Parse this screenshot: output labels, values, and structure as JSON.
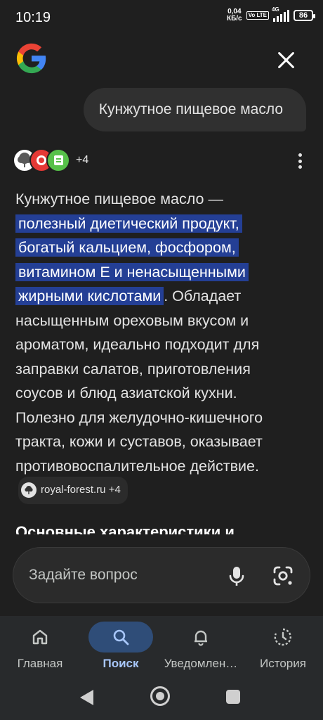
{
  "status_bar": {
    "time": "10:19",
    "net_speed_value": "0,04",
    "net_speed_unit": "КБ/с",
    "volte": "Vo LTE",
    "network": "4G",
    "battery": "86"
  },
  "header": {
    "logo_icon": "google-g-icon",
    "close_icon": "close-icon"
  },
  "query": "Кунжутное пищевое масло",
  "sources": {
    "more_count": "+4",
    "menu_icon": "more-vert-icon"
  },
  "answer": {
    "intro": "Кунжутное пищевое масло — ",
    "highlight": "полезный диетический продукт, богатый кальцием, фосфором, витамином E и ненасыщенными жирными кислотами",
    "rest": ". Обладает насыщенным ореховым вкусом и ароматом, идеально подходит для заправки салатов, приготовления соусов и блюд азиатской кухни. Полезно для желудочно-кишечного тракта, кожи и суставов, оказывает противовоспалительное действие.",
    "citation": "royal-forest.ru +4"
  },
  "section_title": "Основные характеристики и",
  "ask": {
    "placeholder": "Задайте вопрос",
    "mic_icon": "mic-icon",
    "lens_icon": "google-lens-icon"
  },
  "bottom_nav": [
    {
      "label": "Главная",
      "icon": "home-icon",
      "active": false
    },
    {
      "label": "Поиск",
      "icon": "search-icon",
      "active": true
    },
    {
      "label": "Уведомлен…",
      "icon": "bell-icon",
      "active": false
    },
    {
      "label": "История",
      "icon": "history-icon",
      "active": false
    }
  ],
  "colors": {
    "background": "#1f1f1f",
    "highlight": "#243f95",
    "active_nav": "#a8c7fa"
  }
}
